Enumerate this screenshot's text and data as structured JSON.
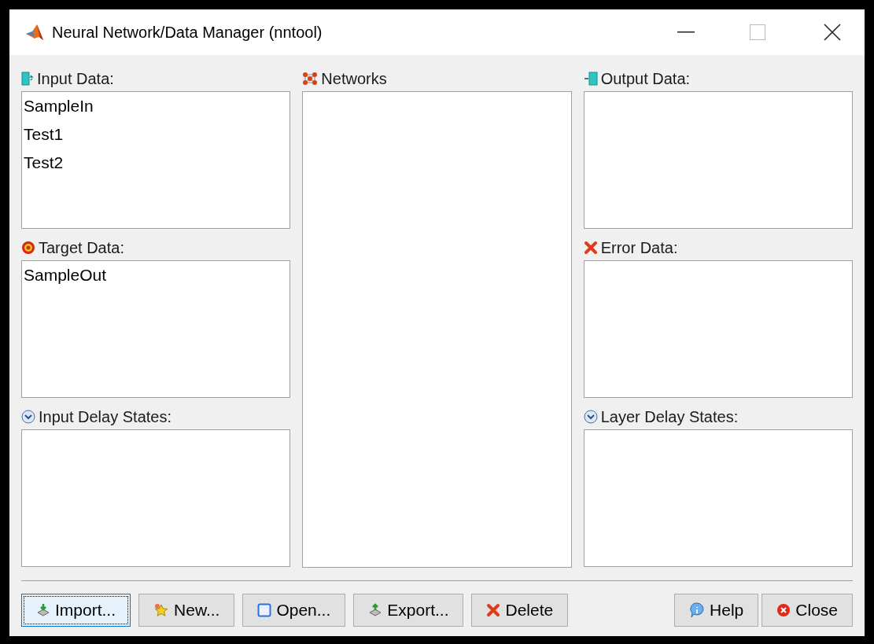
{
  "window": {
    "title": "Neural Network/Data Manager (nntool)"
  },
  "left_panels": [
    {
      "kind": "input",
      "label": "Input Data:",
      "items": [
        "SampleIn",
        "Test1",
        "Test2"
      ]
    },
    {
      "kind": "target",
      "label": "Target Data:",
      "items": [
        "SampleOut"
      ]
    },
    {
      "kind": "delay",
      "label": "Input Delay States:"
    }
  ],
  "networks": {
    "label": "Networks"
  },
  "right_panels": [
    {
      "kind": "output",
      "label": "Output Data:"
    },
    {
      "kind": "error",
      "label": "Error Data:"
    },
    {
      "kind": "delay",
      "label": "Layer Delay States:"
    }
  ],
  "buttons_left": [
    {
      "kind": "import",
      "label": "Import...",
      "focused": true
    },
    {
      "kind": "new",
      "label": "New...",
      "focused": false
    },
    {
      "kind": "open",
      "label": "Open...",
      "focused": false
    },
    {
      "kind": "export",
      "label": "Export...",
      "focused": false
    },
    {
      "kind": "delete",
      "label": "Delete",
      "focused": false
    }
  ],
  "buttons_right": [
    {
      "kind": "help",
      "label": "Help",
      "focused": false
    },
    {
      "kind": "close",
      "label": "Close",
      "focused": false
    }
  ]
}
